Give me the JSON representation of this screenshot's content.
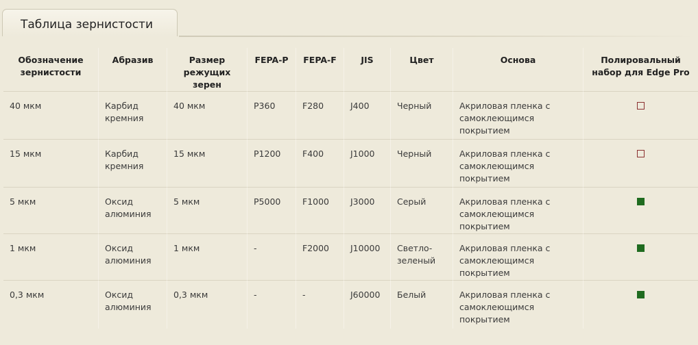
{
  "tab": {
    "title": "Таблица зернистости"
  },
  "table": {
    "headers": [
      "Обозначение зернистости",
      "Абразив",
      "Размер режущих зерен",
      "FEPA-P",
      "FEPA-F",
      "JIS",
      "Цвет",
      "Основа",
      "Полировальный набор для Edge Pro"
    ],
    "rows": [
      {
        "designation": "40 мкм",
        "abrasive": "Карбид кремния",
        "grain_size": "40 мкм",
        "fepa_p": "P360",
        "fepa_f": "F280",
        "jis": "J400",
        "color": "Черный",
        "backing": "Акриловая пленка с самоклеющимся покрытием",
        "in_polishing_kit": false
      },
      {
        "designation": "15 мкм",
        "abrasive": "Карбид кремния",
        "grain_size": "15 мкм",
        "fepa_p": "P1200",
        "fepa_f": "F400",
        "jis": "J1000",
        "color": "Черный",
        "backing": "Акриловая пленка с самоклеющимся покрытием",
        "in_polishing_kit": false
      },
      {
        "designation": "5 мкм",
        "abrasive": "Оксид алюминия",
        "grain_size": "5 мкм",
        "fepa_p": "P5000",
        "fepa_f": "F1000",
        "jis": "J3000",
        "color": "Серый",
        "backing": "Акриловая пленка с самоклеющимся покрытием",
        "in_polishing_kit": true
      },
      {
        "designation": "1 мкм",
        "abrasive": "Оксид алюминия",
        "grain_size": "1 мкм",
        "fepa_p": "-",
        "fepa_f": "F2000",
        "jis": "J10000",
        "color": "Светло-зеленый",
        "backing": "Акриловая пленка с самоклеющимся покрытием",
        "in_polishing_kit": true
      },
      {
        "designation": "0,3 мкм",
        "abrasive": "Оксид алюминия",
        "grain_size": "0,3 мкм",
        "fepa_p": "-",
        "fepa_f": "-",
        "jis": "J60000",
        "color": "Белый",
        "backing": "Акриловая пленка с самоклеющимся покрытием",
        "in_polishing_kit": true
      }
    ]
  },
  "colors": {
    "background": "#eeeadb",
    "checked": "#1f6b1f",
    "unchecked_border": "#8a2f2f"
  },
  "icons": {
    "checked": "filled-square-icon",
    "unchecked": "empty-square-icon"
  }
}
